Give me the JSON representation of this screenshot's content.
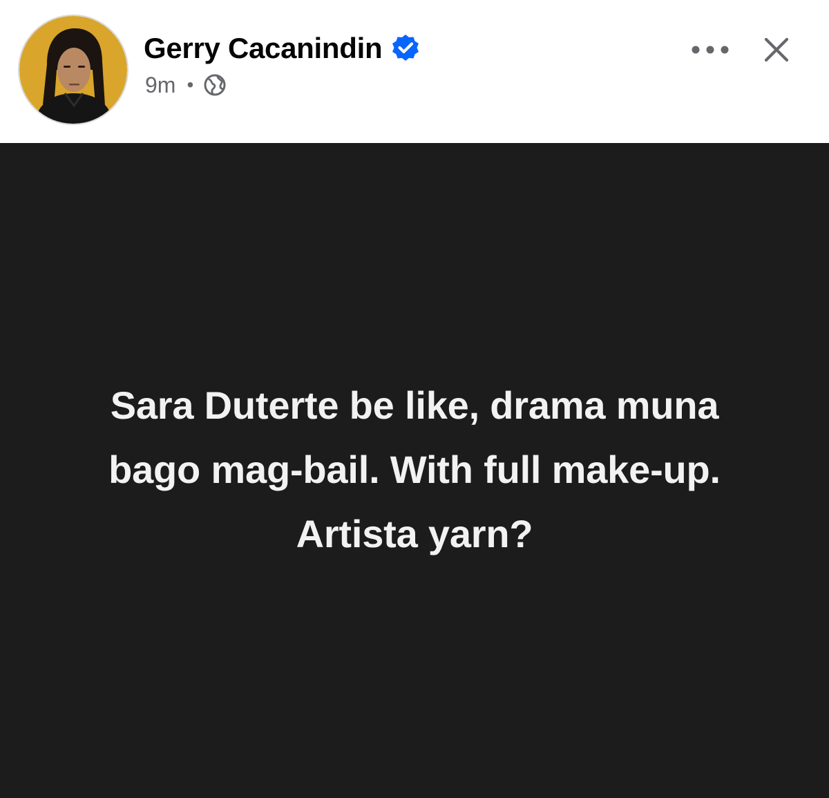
{
  "post": {
    "author": {
      "name": "Gerry Cacanindin",
      "verified": true,
      "avatar_icon": "profile-photo"
    },
    "meta": {
      "time": "9m",
      "separator": "•",
      "audience_icon": "globe-icon"
    },
    "actions": {
      "more_icon": "more-options-icon",
      "close_icon": "close-icon"
    },
    "content": {
      "lines": [
        "Sara Duterte be like, drama muna",
        "bago mag-bail. With full make-up.",
        "Artista yarn?"
      ],
      "background_color": "#1c1c1c",
      "text_color": "#f2f2f2"
    }
  },
  "colors": {
    "verified_badge": "#0866ff",
    "secondary_text": "#65676b",
    "avatar_background": "#d9a52a"
  }
}
